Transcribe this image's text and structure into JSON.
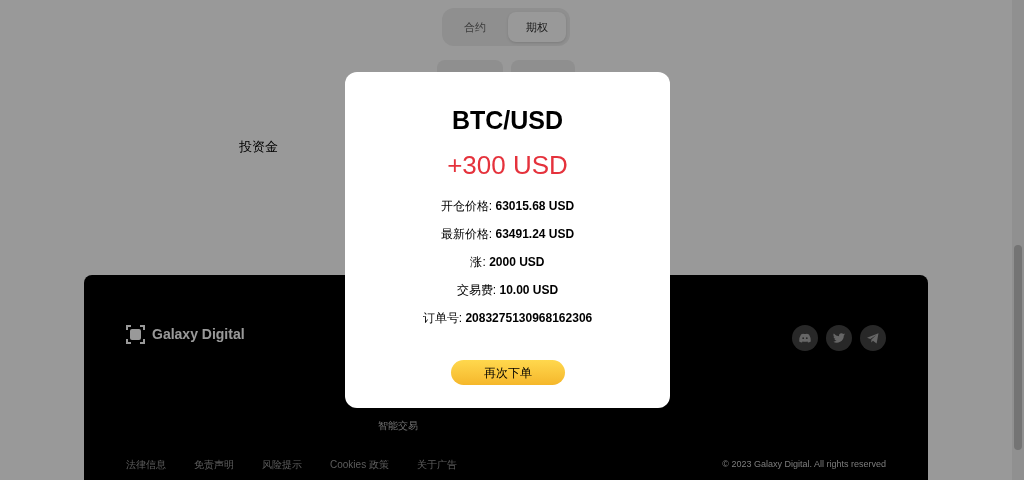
{
  "tabs": [
    {
      "label": "合约",
      "selected": false
    },
    {
      "label": "期权",
      "selected": true
    }
  ],
  "form": {
    "label": "投资金"
  },
  "footer": {
    "brand": "Galaxy Digital",
    "links": [
      "智能交易"
    ],
    "bottom_links": [
      "法律信息",
      "免责声明",
      "风险提示",
      "Cookies 政策",
      "关于广告"
    ],
    "copyright": "© 2023 Galaxy Digital. All rights reserved"
  },
  "modal": {
    "title": "BTC/USD",
    "amount": "+300 USD",
    "rows": [
      {
        "label": "开仓价格:",
        "value": "63015.68 USD"
      },
      {
        "label": "最新价格:",
        "value": "63491.24 USD"
      },
      {
        "label": "涨:",
        "value": "2000 USD"
      },
      {
        "label": "交易费:",
        "value": "10.00 USD"
      },
      {
        "label": "订单号:",
        "value": "2083275130968162306"
      }
    ],
    "button": "再次下单"
  }
}
